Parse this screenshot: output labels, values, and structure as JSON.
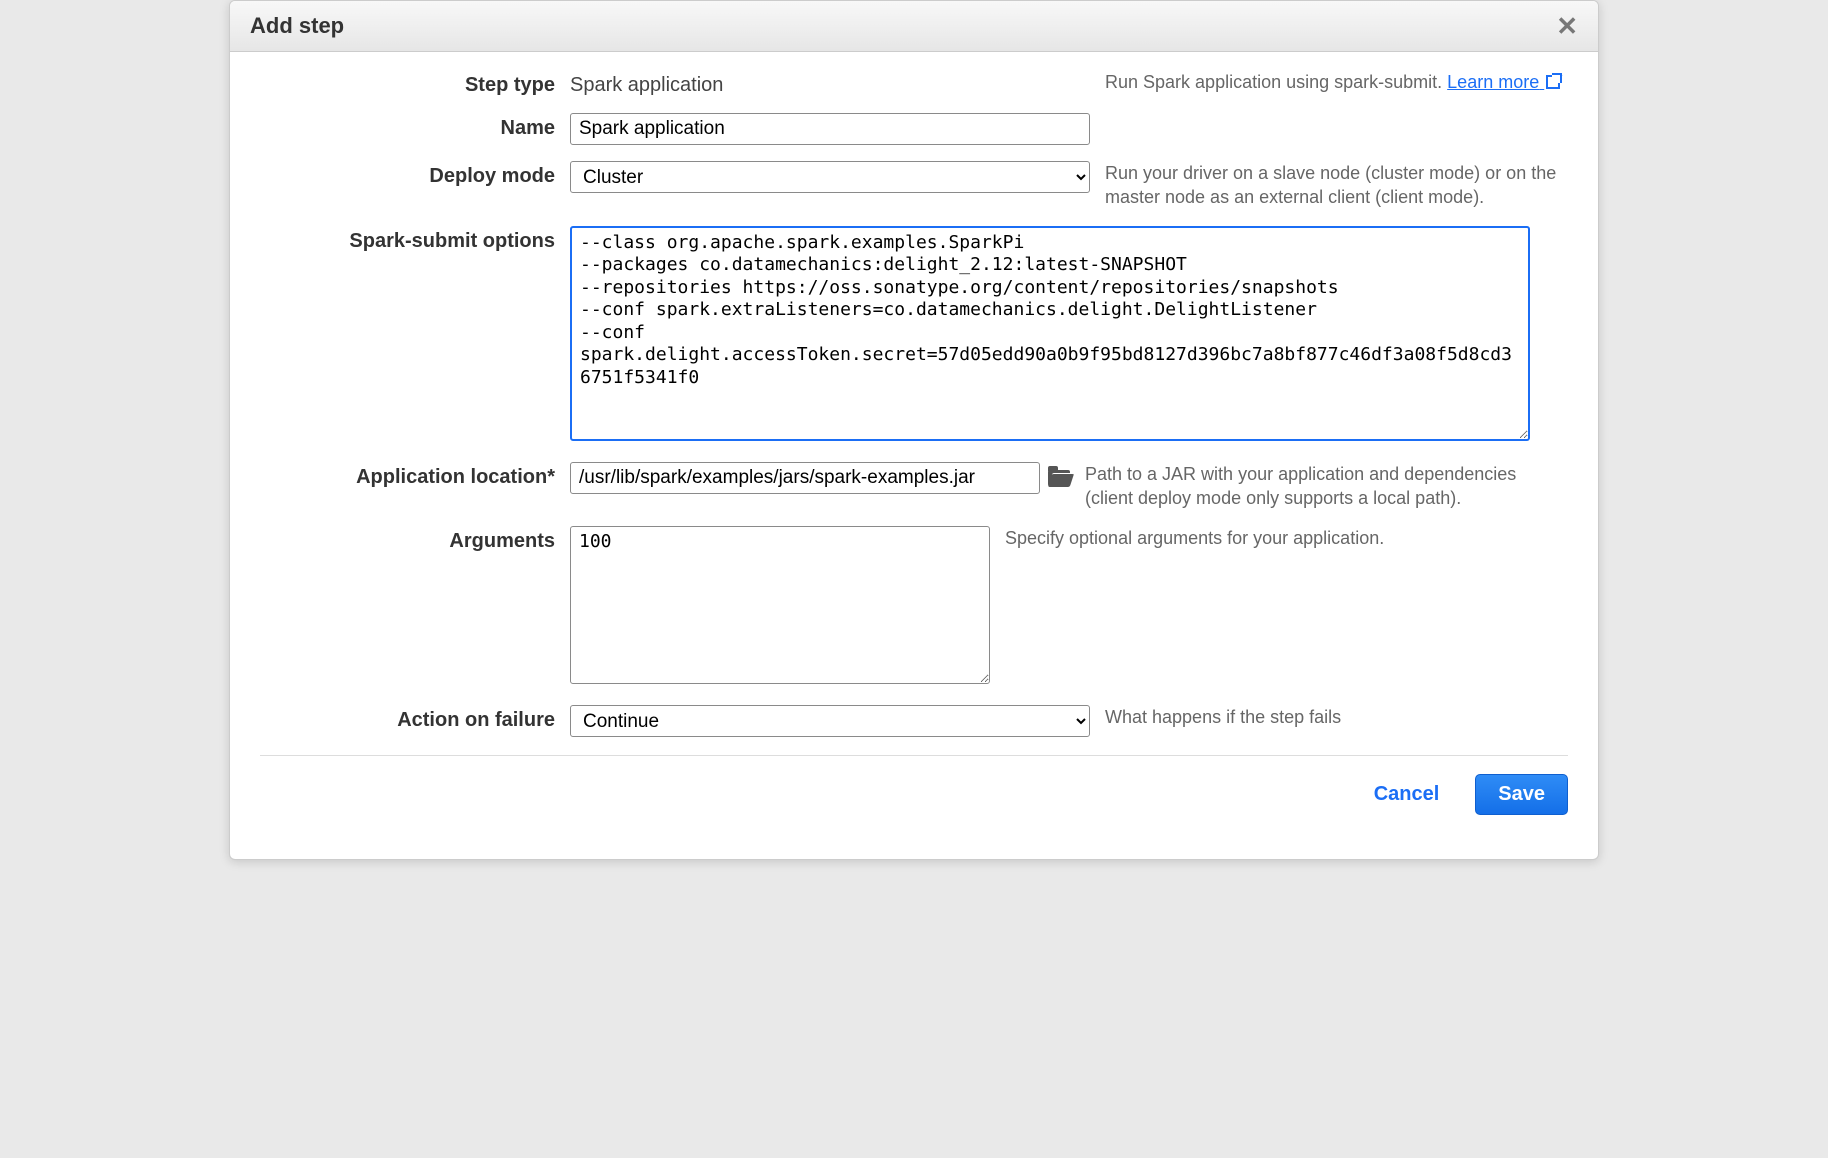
{
  "modal": {
    "title": "Add step",
    "fields": {
      "step_type": {
        "label": "Step type",
        "value": "Spark application",
        "desc_prefix": "Run Spark application using spark-submit. ",
        "link": "Learn more"
      },
      "name": {
        "label": "Name",
        "value": "Spark application"
      },
      "deploy_mode": {
        "label": "Deploy mode",
        "value": "Cluster",
        "desc": "Run your driver on a slave node (cluster mode) or on the master node as an external client (client mode)."
      },
      "spark_submit": {
        "label": "Spark-submit options",
        "value": "--class org.apache.spark.examples.SparkPi\n--packages co.datamechanics:delight_2.12:latest-SNAPSHOT\n--repositories https://oss.sonatype.org/content/repositories/snapshots\n--conf spark.extraListeners=co.datamechanics.delight.DelightListener\n--conf spark.delight.accessToken.secret=57d05edd90a0b9f95bd8127d396bc7a8bf877c46df3a08f5d8cd36751f5341f0"
      },
      "app_location": {
        "label": "Application location*",
        "value": "/usr/lib/spark/examples/jars/spark-examples.jar",
        "desc": "Path to a JAR with your application and dependencies (client deploy mode only supports a local path)."
      },
      "arguments": {
        "label": "Arguments",
        "value": "100",
        "desc": "Specify optional arguments for your application."
      },
      "action_on_failure": {
        "label": "Action on failure",
        "value": "Continue",
        "desc": "What happens if the step fails"
      }
    },
    "footer": {
      "cancel": "Cancel",
      "save": "Save"
    }
  }
}
